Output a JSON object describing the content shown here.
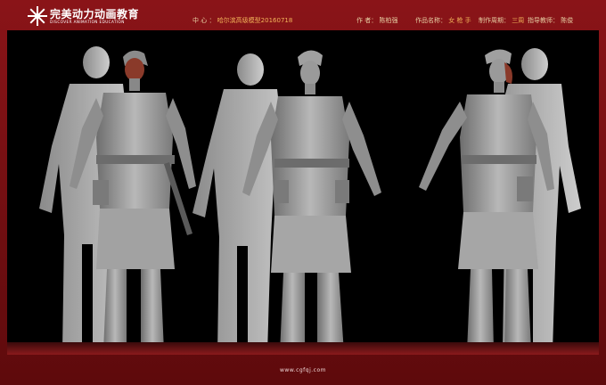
{
  "logo": {
    "title": "完美动力动画教育",
    "subtitle": "DISCOVER ANIMATION EDUCATION"
  },
  "header": {
    "center_label": "中  心 ：",
    "center_value": "哈尔滨高级模型20160718",
    "author_label": "作  者：",
    "author_value": "陈柏强",
    "work_label": "作品名称：",
    "work_value": "女 枪 手",
    "cycle_label": "制作周期：",
    "cycle_value": "三周",
    "teacher_label": "指导教师：",
    "teacher_value": "陈俊"
  },
  "footer": {
    "url": "www.cgfqj.com"
  },
  "colors": {
    "frame": "#6d0b0d",
    "accent_text": "#f2b45a",
    "model_gray": "#9a9a9a",
    "shadow_gray": "#d4d4d4"
  }
}
